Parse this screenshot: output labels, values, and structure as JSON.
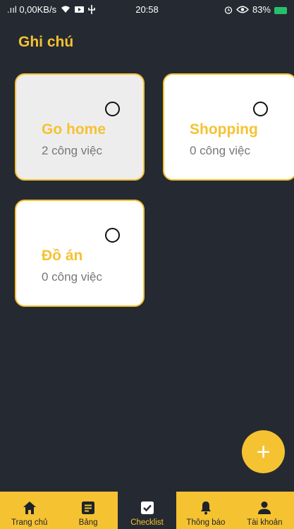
{
  "status_bar": {
    "signal_text": ".ııl 0,00KB/s",
    "time": "20:58",
    "battery": "83%"
  },
  "header": {
    "title": "Ghi chú"
  },
  "cards": [
    {
      "title": "Go home",
      "count": "2 công việc"
    },
    {
      "title": "Shopping",
      "count": "0 công việc"
    },
    {
      "title": "Đồ án",
      "count": "0 công việc"
    }
  ],
  "fab": {
    "label": "+"
  },
  "bottom_nav": {
    "items": [
      {
        "label": "Trang chủ",
        "icon": "home-icon"
      },
      {
        "label": "Bảng",
        "icon": "note-icon"
      },
      {
        "label": "Checklist",
        "icon": "checkbox-icon",
        "active": true
      },
      {
        "label": "Thông báo",
        "icon": "bell-icon"
      },
      {
        "label": "Tài khoản",
        "icon": "user-icon"
      }
    ]
  },
  "colors": {
    "accent": "#f5c232",
    "background": "#252a32"
  }
}
